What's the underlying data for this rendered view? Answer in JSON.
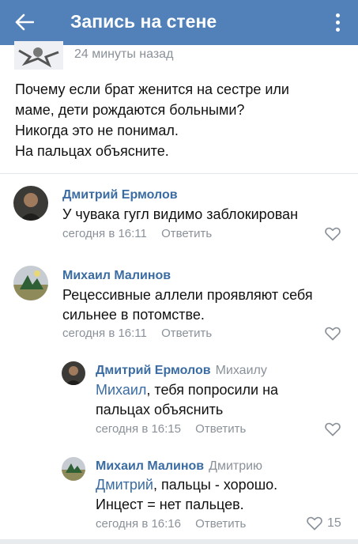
{
  "appbar": {
    "title": "Запись на стене",
    "back_icon": "arrow-left-icon",
    "more_icon": "more-vertical-icon"
  },
  "post": {
    "time": "24 минуты назад",
    "lines": [
      "Почему если брат женится на сестре или",
      "маме, дети рождаются больными?",
      "Никогда это не понимал.",
      "На пальцах объясните."
    ]
  },
  "comments": [
    {
      "author": "Дмитрий Ермолов",
      "reply_to": "",
      "mention": "",
      "lines": [
        "У чувака гугл видимо заблокирован"
      ],
      "time": "сегодня в 16:11",
      "reply_label": "Ответить",
      "likes": ""
    },
    {
      "author": "Михаил Малинов",
      "reply_to": "",
      "mention": "",
      "lines": [
        "Рецессивные аллели проявляют себя",
        "сильнее в потомстве."
      ],
      "time": "сегодня в 16:11",
      "reply_label": "Ответить",
      "likes": ""
    },
    {
      "author": "Дмитрий Ермолов",
      "reply_to": "Михаилу",
      "mention": "Михаил",
      "lines": [
        ", тебя попросили на",
        "пальцах объяснить"
      ],
      "time": "сегодня в 16:15",
      "reply_label": "Ответить",
      "likes": ""
    },
    {
      "author": "Михаил Малинов",
      "reply_to": "Дмитрию",
      "mention": "Дмитрий",
      "lines": [
        ", пальцы - хорошо.",
        "Инцест = нет пальцев."
      ],
      "time": "сегодня в 16:16",
      "reply_label": "Ответить",
      "likes": "15"
    }
  ],
  "colors": {
    "header": "#5181b8",
    "link": "#3a6ca3",
    "meta": "#8a9199"
  }
}
